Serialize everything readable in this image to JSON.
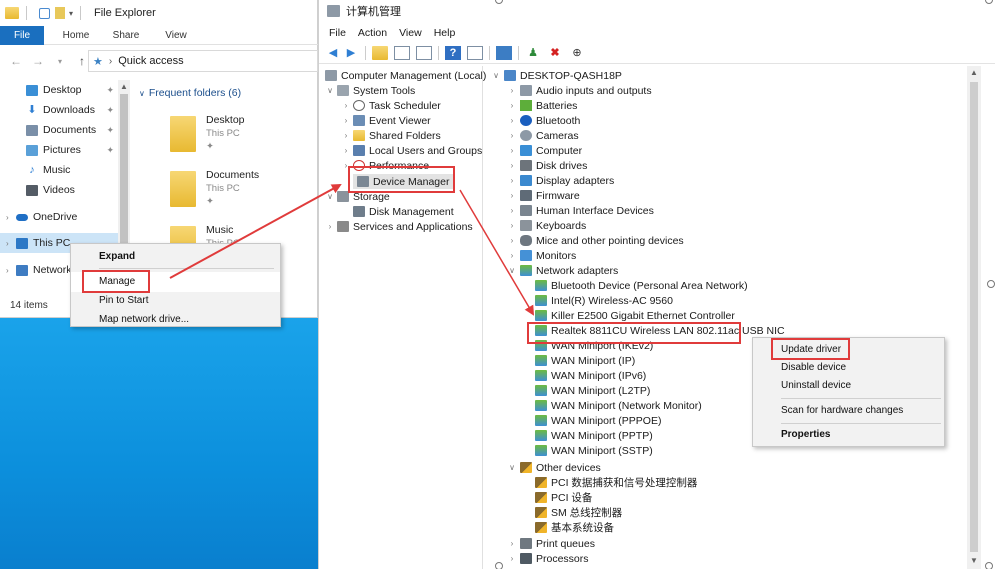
{
  "explorer": {
    "title": "File Explorer",
    "ribbon": {
      "file": "File",
      "tabs": [
        "Home",
        "Share",
        "View"
      ]
    },
    "address": {
      "path": "Quick access"
    },
    "nav": [
      {
        "label": "Desktop",
        "pinned": true
      },
      {
        "label": "Downloads",
        "pinned": true
      },
      {
        "label": "Documents",
        "pinned": true
      },
      {
        "label": "Pictures",
        "pinned": true
      },
      {
        "label": "Music",
        "pinned": false
      },
      {
        "label": "Videos",
        "pinned": false
      },
      {
        "label": "OneDrive",
        "pinned": false
      },
      {
        "label": "This PC",
        "pinned": false
      },
      {
        "label": "Network",
        "pinned": false
      }
    ],
    "content": {
      "header": "Frequent folders (6)",
      "folders": [
        {
          "name": "Desktop",
          "location": "This PC"
        },
        {
          "name": "Documents",
          "location": "This PC"
        },
        {
          "name": "Music",
          "location": "This PC"
        }
      ]
    },
    "status": "14 items",
    "context_menu": [
      "Expand",
      "Manage",
      "Pin to Start",
      "Map network drive..."
    ]
  },
  "cm": {
    "title": "计算机管理",
    "menu": [
      "File",
      "Action",
      "View",
      "Help"
    ],
    "tree": {
      "root": "Computer Management (Local)",
      "system_tools": "System Tools",
      "system_children": [
        "Task Scheduler",
        "Event Viewer",
        "Shared Folders",
        "Local Users and Groups",
        "Performance",
        "Device Manager"
      ],
      "storage": "Storage",
      "storage_children": [
        "Disk Management"
      ],
      "services": "Services and Applications"
    },
    "devices": {
      "computer": "DESKTOP-QASH18P",
      "categories_top": [
        "Audio inputs and outputs",
        "Batteries",
        "Bluetooth",
        "Cameras",
        "Computer",
        "Disk drives",
        "Display adapters",
        "Firmware",
        "Human Interface Devices",
        "Keyboards",
        "Mice and other pointing devices",
        "Monitors"
      ],
      "network_adapters": "Network adapters",
      "network_children": [
        "Bluetooth Device (Personal Area Network)",
        "Intel(R) Wireless-AC 9560",
        "Killer E2500 Gigabit Ethernet Controller",
        "Realtek 8811CU Wireless LAN 802.11ac USB NIC",
        "WAN Miniport (IKEv2)",
        "WAN Miniport (IP)",
        "WAN Miniport (IPv6)",
        "WAN Miniport (L2TP)",
        "WAN Miniport (Network Monitor)",
        "WAN Miniport (PPPOE)",
        "WAN Miniport (PPTP)",
        "WAN Miniport (SSTP)"
      ],
      "other_devices": "Other devices",
      "other_children": [
        "PCI 数据捕获和信号处理控制器",
        "PCI 设备",
        "SM 总线控制器",
        "基本系统设备"
      ],
      "categories_bottom": [
        "Print queues",
        "Processors"
      ]
    },
    "context_menu": [
      "Update driver",
      "Disable device",
      "Uninstall device",
      "Scan for hardware changes",
      "Properties"
    ]
  },
  "colors": {
    "annotation_red": "#e03b3b",
    "file_tab": "#1a6fbf",
    "wallpaper": "#0a8bd6"
  }
}
